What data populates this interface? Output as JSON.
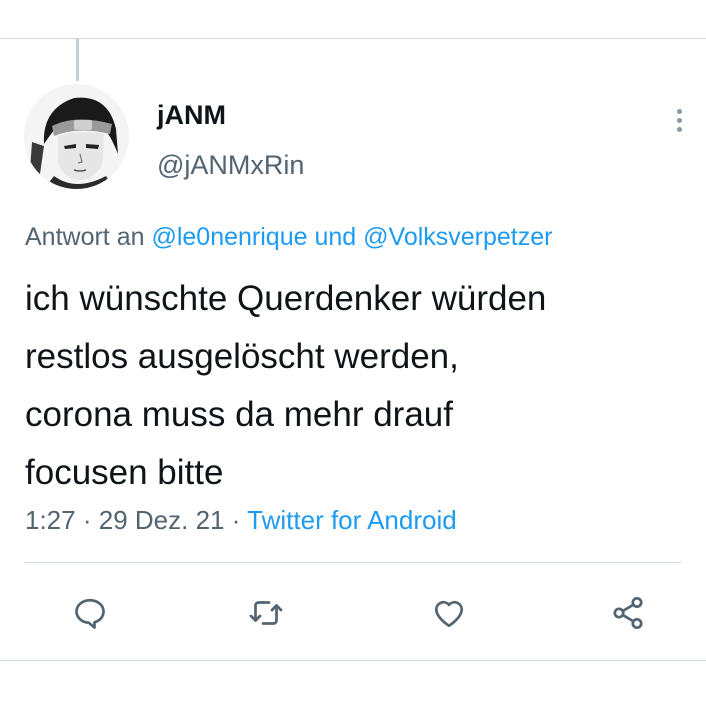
{
  "tweet": {
    "display_name": "jANM",
    "handle": "@jANMxRin",
    "reply_prefix": "Antwort an",
    "reply_mention_1": "@le0nenrique",
    "reply_conjunction": "und",
    "reply_mention_2": "@Volksverpetzer",
    "text_lines": [
      "ich wünschte Querdenker würden",
      "restlos ausgelöscht werden,",
      "corona muss da mehr drauf",
      "focusen bitte"
    ],
    "time": "1:27",
    "date": "29 Dez. 21",
    "separator": "·",
    "source": "Twitter for Android"
  },
  "icons": {
    "avatar": "anime-character-avatar",
    "more": "more-vertical-icon",
    "reply": "reply-icon",
    "retweet": "retweet-icon",
    "like": "heart-icon",
    "share": "share-icon"
  },
  "colors": {
    "accent": "#1d9bf0",
    "secondary_text": "#536471",
    "icon": "#536471",
    "divider": "#cfd9de"
  }
}
